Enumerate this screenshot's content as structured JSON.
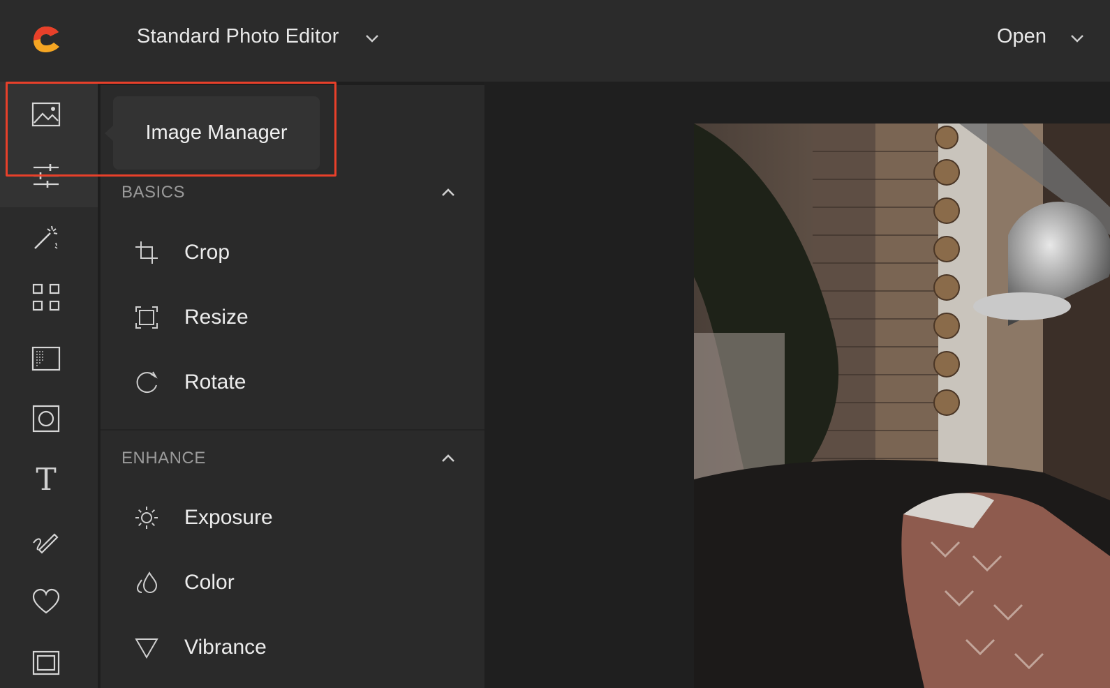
{
  "app": {
    "editor_mode": "Standard Photo Editor",
    "open_label": "Open",
    "accent_color": "#f5a623",
    "highlight_color": "#e8402a"
  },
  "rail": {
    "items": [
      {
        "icon": "image-icon",
        "name": "Image Manager"
      },
      {
        "icon": "sliders-icon"
      },
      {
        "icon": "magic-wand-icon"
      },
      {
        "icon": "grid-icon"
      },
      {
        "icon": "texture-icon"
      },
      {
        "icon": "frame-circle-icon"
      },
      {
        "icon": "text-icon",
        "glyph": "T"
      },
      {
        "icon": "draw-icon"
      },
      {
        "icon": "heart-icon"
      },
      {
        "icon": "border-icon"
      }
    ]
  },
  "tooltip": {
    "label": "Image Manager"
  },
  "panel": {
    "sections": [
      {
        "title": "BASICS",
        "expanded": true,
        "items": [
          {
            "icon": "crop-icon",
            "label": "Crop"
          },
          {
            "icon": "resize-icon",
            "label": "Resize"
          },
          {
            "icon": "rotate-icon",
            "label": "Rotate"
          }
        ]
      },
      {
        "title": "ENHANCE",
        "expanded": true,
        "items": [
          {
            "icon": "exposure-icon",
            "label": "Exposure"
          },
          {
            "icon": "color-icon",
            "label": "Color"
          },
          {
            "icon": "vibrance-icon",
            "label": "Vibrance"
          }
        ]
      }
    ]
  }
}
